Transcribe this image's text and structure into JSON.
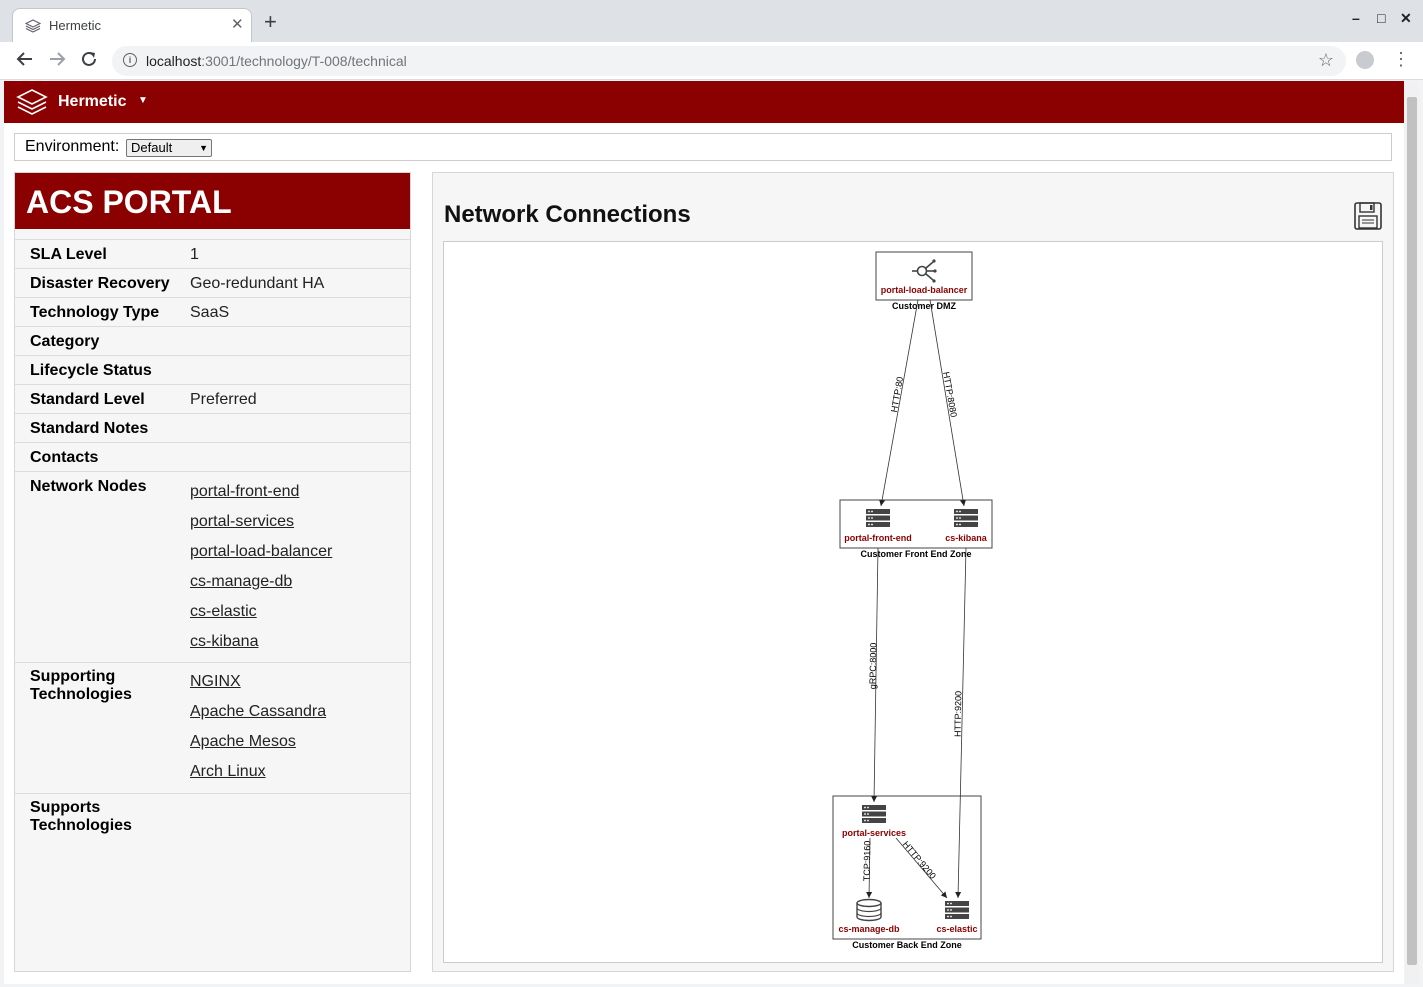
{
  "browser": {
    "tab_title": "Hermetic",
    "tab_close": "✕",
    "new_tab": "+",
    "url_host": "localhost",
    "url_path": ":3001/technology/T-008/technical",
    "window_minimize": "–",
    "window_maximize": "□",
    "window_close": "✕"
  },
  "app": {
    "name": "Hermetic",
    "accent": "#8b0000"
  },
  "environment": {
    "label": "Environment:",
    "selected": "Default"
  },
  "technology": {
    "title": "ACS PORTAL",
    "fields": [
      {
        "label": "SLA Level",
        "value": "1"
      },
      {
        "label": "Disaster Recovery",
        "value": "Geo-redundant HA"
      },
      {
        "label": "Technology Type",
        "value": "SaaS"
      },
      {
        "label": "Category",
        "value": ""
      },
      {
        "label": "Lifecycle Status",
        "value": ""
      },
      {
        "label": "Standard Level",
        "value": "Preferred"
      },
      {
        "label": "Standard Notes",
        "value": ""
      },
      {
        "label": "Contacts",
        "value": ""
      }
    ],
    "network_nodes_label": "Network Nodes",
    "network_nodes": [
      "portal-front-end",
      "portal-services",
      "portal-load-balancer",
      "cs-manage-db",
      "cs-elastic",
      "cs-kibana"
    ],
    "supporting_label": "Supporting Technologies",
    "supporting": [
      "NGINX",
      "Apache Cassandra",
      "Apache Mesos",
      "Arch Linux"
    ],
    "supports_label": "Supports Technologies"
  },
  "network": {
    "title": "Network Connections",
    "zones": [
      {
        "name": "Customer DMZ"
      },
      {
        "name": "Customer Front End Zone"
      },
      {
        "name": "Customer Back End Zone"
      }
    ],
    "nodes": [
      "portal-load-balancer",
      "portal-front-end",
      "cs-kibana",
      "portal-services",
      "cs-manage-db",
      "cs-elastic"
    ],
    "edges": [
      {
        "from": "portal-load-balancer",
        "to": "portal-front-end",
        "label": "HTTP:80"
      },
      {
        "from": "portal-load-balancer",
        "to": "cs-kibana",
        "label": "HTTP:8080"
      },
      {
        "from": "portal-front-end",
        "to": "portal-services",
        "label": "gRPC:8000"
      },
      {
        "from": "cs-kibana",
        "to": "cs-elastic",
        "label": "HTTP:9200"
      },
      {
        "from": "portal-services",
        "to": "cs-manage-db",
        "label": "TCP:9160"
      },
      {
        "from": "portal-services",
        "to": "cs-elastic",
        "label": "HTTP:9200"
      }
    ]
  }
}
